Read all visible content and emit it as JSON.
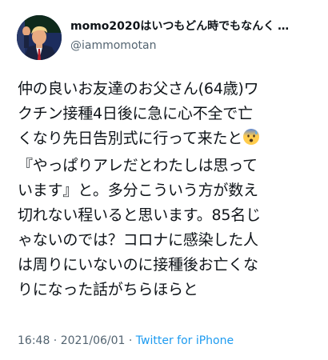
{
  "user": {
    "display_name": "momo2020はいつもどん時でもなんく",
    "handle": "@iammomotan"
  },
  "tweet": {
    "lines": [
      "仲の良いお友達のお父さん(64歳)ワ",
      "クチン接種4日後に急に心不全で亡",
      "くなり先日告別式に行って来たと",
      "『やっぱりアレだとわたしは思って",
      "います』と。多分こういう方が数え",
      "切れない程いると思います。85名じ",
      "ゃないのでは？コロナに感染した人",
      "は周りにいないのに接種後お亡くな",
      "りになった話がちらほらと"
    ],
    "emoji": "anxious-face-with-sweat"
  },
  "meta": {
    "time": "16:48",
    "separator": " · ",
    "date": "2021/06/01",
    "source": "Twitter for iPhone"
  },
  "colors": {
    "text": "#0f1419",
    "secondary": "#536471",
    "link": "#1d9bf0"
  }
}
